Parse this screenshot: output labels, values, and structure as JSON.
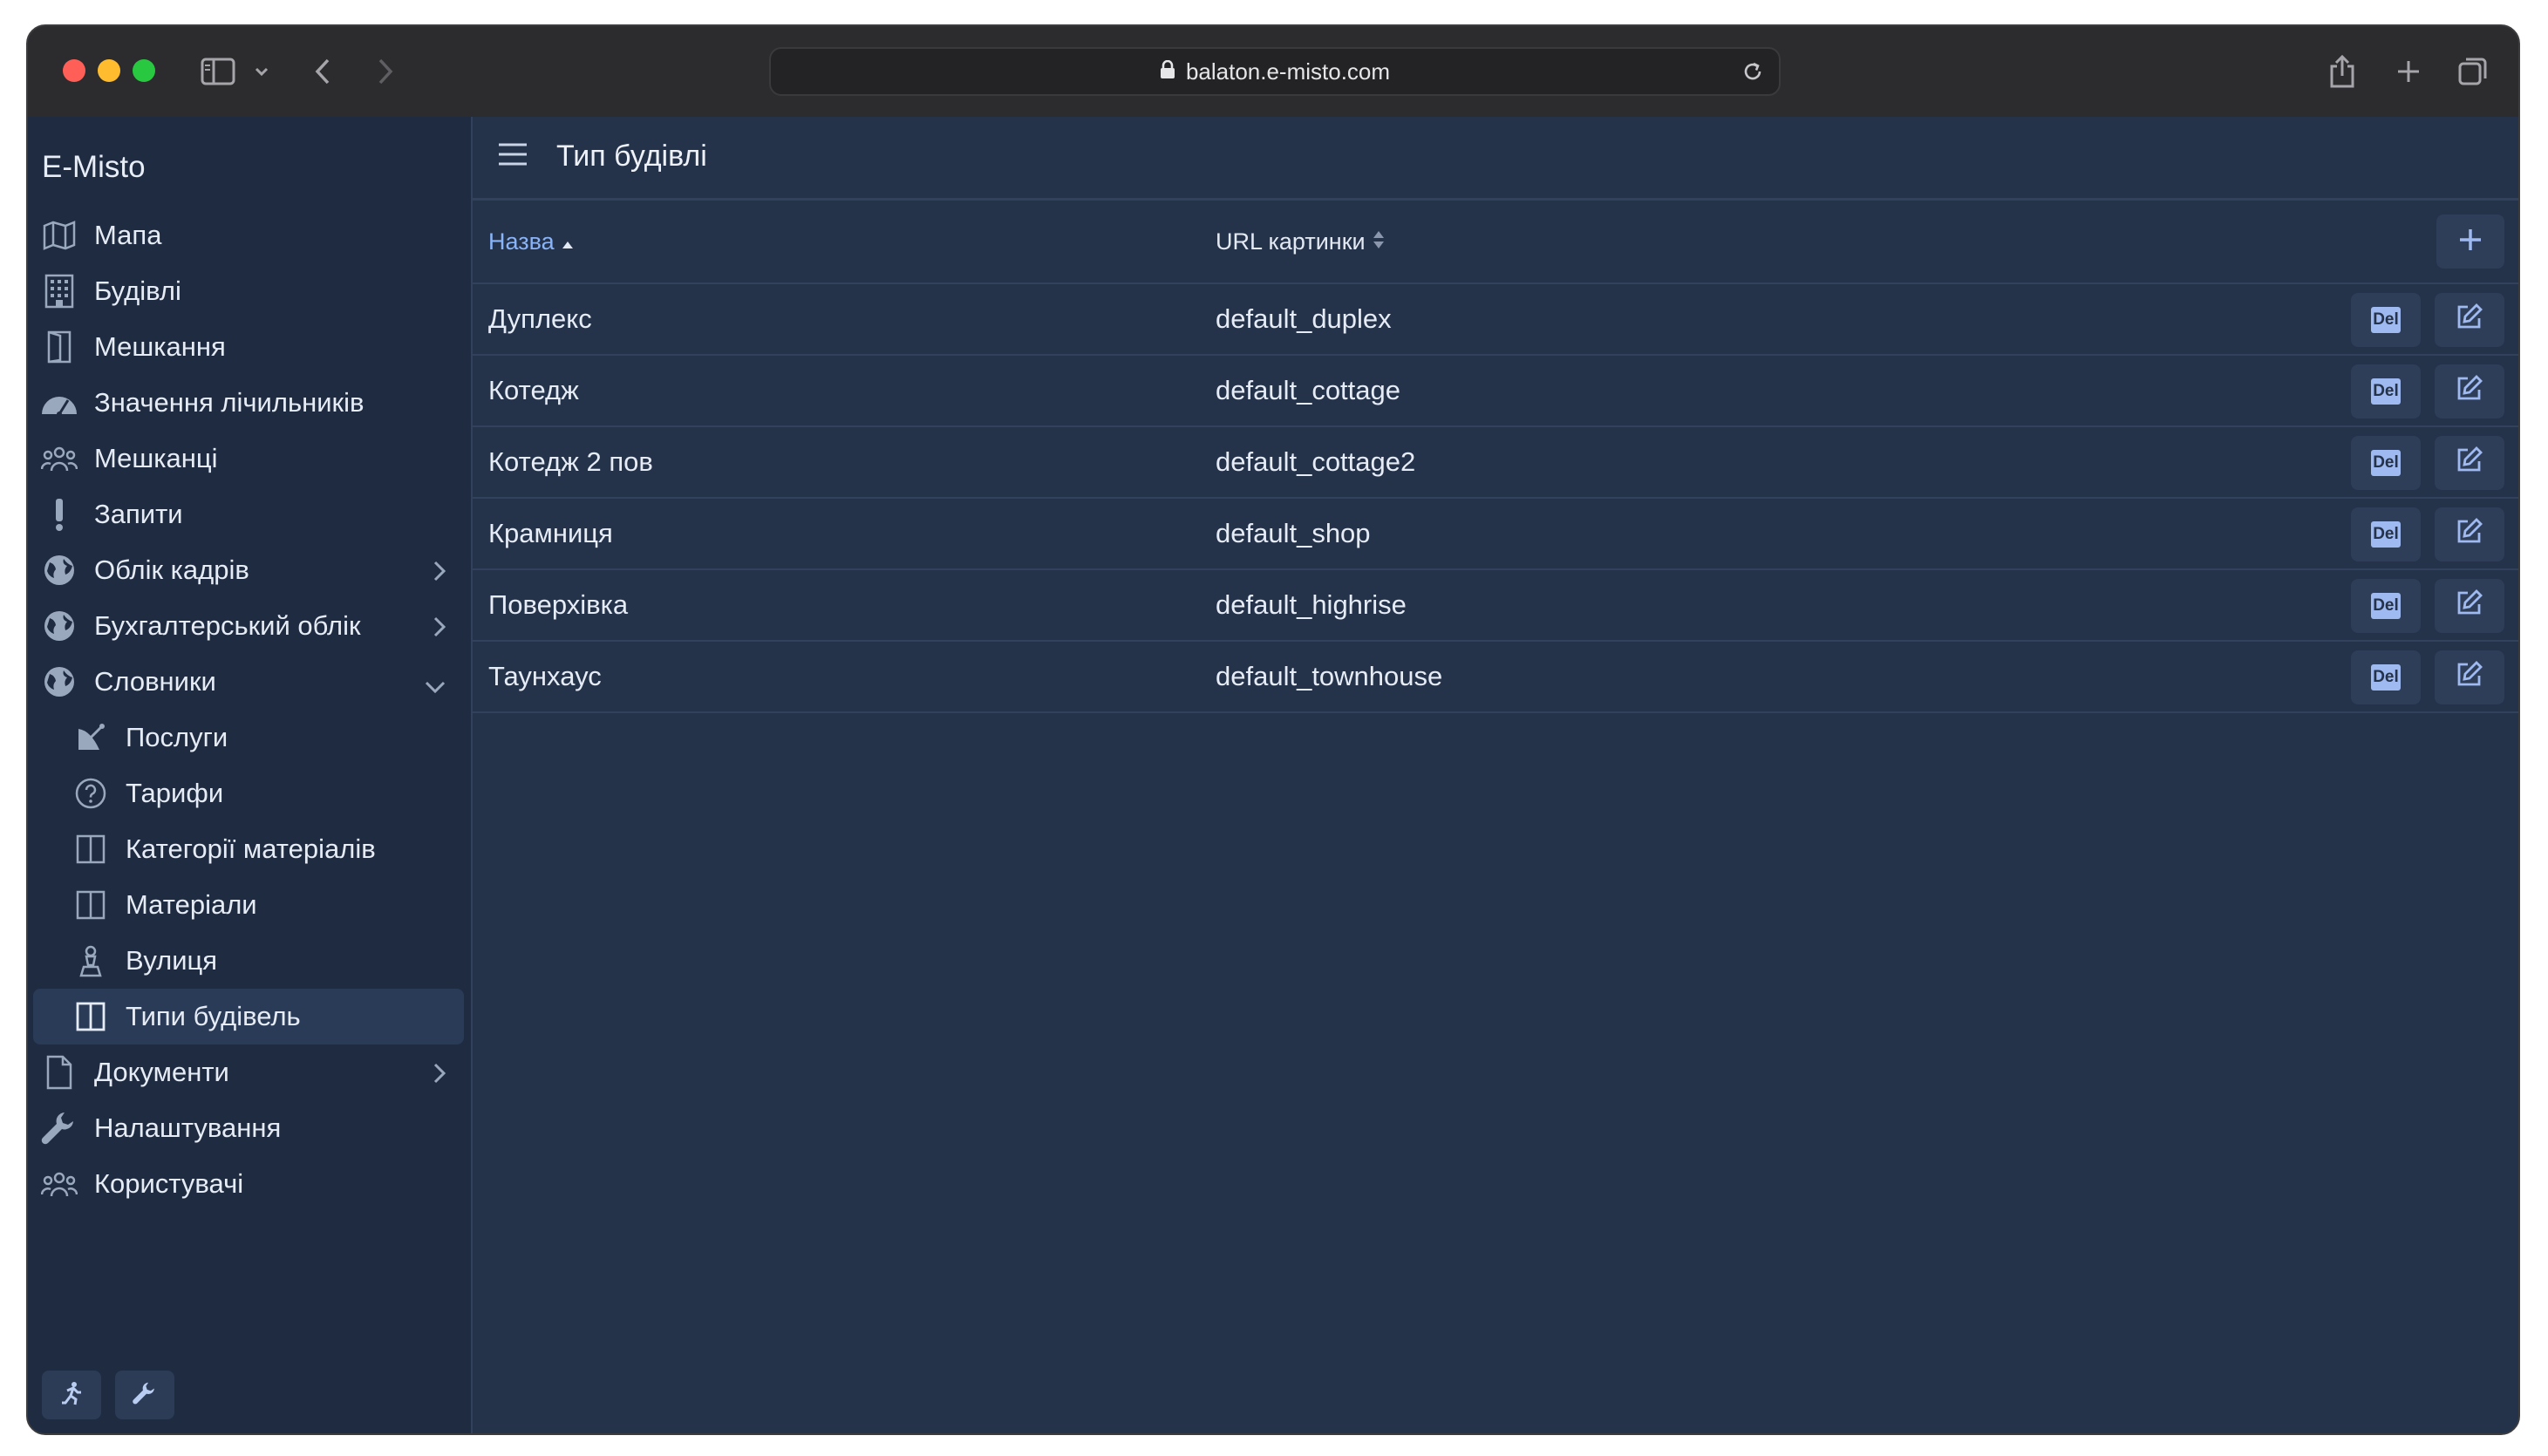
{
  "browser": {
    "url": "balaton.e-misto.com"
  },
  "sidebar": {
    "brand": "E-Misto",
    "items": [
      {
        "label": "Мапа",
        "icon": "map-icon"
      },
      {
        "label": "Будівлі",
        "icon": "building-icon"
      },
      {
        "label": "Мешкання",
        "icon": "door-icon"
      },
      {
        "label": "Значення лічильників",
        "icon": "gauge-icon"
      },
      {
        "label": "Мешканці",
        "icon": "users-icon"
      },
      {
        "label": "Запити",
        "icon": "exclamation-icon"
      },
      {
        "label": "Облік кадрів",
        "icon": "globe-icon"
      },
      {
        "label": "Бухгалтерський облік",
        "icon": "globe-icon"
      },
      {
        "label": "Словники",
        "icon": "globe-icon"
      },
      {
        "label": "Послуги",
        "icon": "satellite-icon"
      },
      {
        "label": "Тарифи",
        "icon": "question-icon"
      },
      {
        "label": "Категорії матеріалів",
        "icon": "columns-icon"
      },
      {
        "label": "Матеріали",
        "icon": "columns-icon"
      },
      {
        "label": "Вулиця",
        "icon": "chess-pawn-icon"
      },
      {
        "label": "Типи будівель",
        "icon": "columns-icon"
      },
      {
        "label": "Документи",
        "icon": "document-icon"
      },
      {
        "label": "Налаштування",
        "icon": "wrench-icon"
      },
      {
        "label": "Користувачі",
        "icon": "users-icon"
      }
    ]
  },
  "main": {
    "title": "Тип будівлі",
    "columns": {
      "name": "Назва",
      "url": "URL картинки"
    },
    "delete_label": "Del",
    "rows": [
      {
        "name": "Дуплекс",
        "url": "default_duplex"
      },
      {
        "name": "Котедж",
        "url": "default_cottage"
      },
      {
        "name": "Котедж 2 пов",
        "url": "default_cottage2"
      },
      {
        "name": "Крамниця",
        "url": "default_shop"
      },
      {
        "name": "Поверхівка",
        "url": "default_highrise"
      },
      {
        "name": "Таунхаус",
        "url": "default_townhouse"
      }
    ]
  },
  "colors": {
    "sidebar_bg": "#1f2b40",
    "main_bg": "#24324a",
    "accent": "#8ab4f8",
    "active_item": "#2a3b57"
  }
}
